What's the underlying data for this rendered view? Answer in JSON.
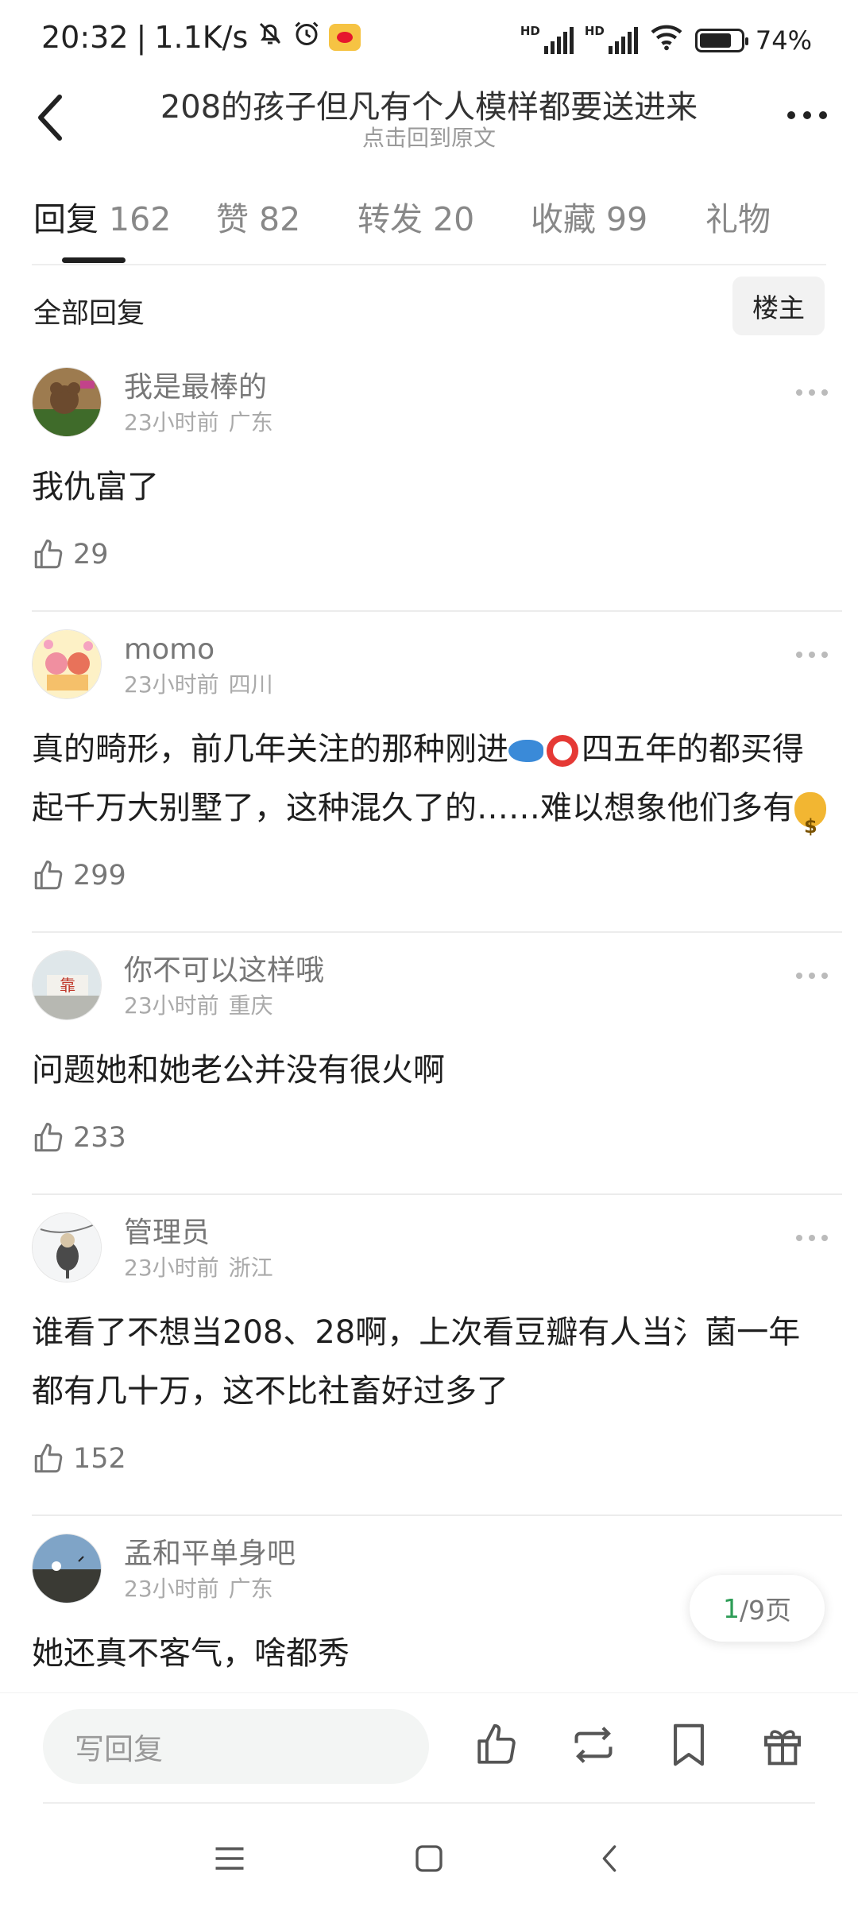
{
  "status_bar": {
    "time": "20:32",
    "net_speed": "1.1K/s",
    "hd1": "HD",
    "hd2": "HD",
    "battery": "74%"
  },
  "header": {
    "title": "208的孩子但凡有个人模样都要送进来",
    "subtitle": "点击回到原文"
  },
  "tabs": [
    {
      "label": "回复",
      "count": "162"
    },
    {
      "label": "赞",
      "count": "82"
    },
    {
      "label": "转发",
      "count": "20"
    },
    {
      "label": "收藏",
      "count": "99"
    },
    {
      "label": "礼物",
      "count": ""
    }
  ],
  "filter": {
    "all_label": "全部回复",
    "op_label": "楼主"
  },
  "comments": [
    {
      "name": "我是最棒的",
      "time": "23小时前",
      "location": "广东",
      "text": "我仇富了",
      "likes": "29"
    },
    {
      "name": "momo",
      "time": "23小时前",
      "location": "四川",
      "text_a": "真的畸形，前几年关注的那种刚进",
      "text_b": "四五年的都买得起千万大别墅了，这种混久了的……难以想象他们多有",
      "likes": "299"
    },
    {
      "name": "你不可以这样哦",
      "time": "23小时前",
      "location": "重庆",
      "text": "问题她和她老公并没有很火啊",
      "likes": "233"
    },
    {
      "name": "管理员",
      "time": "23小时前",
      "location": "浙江",
      "text": "谁看了不想当208、28啊，上次看豆瓣有人当氵菌一年都有几十万，这不比社畜好过多了",
      "likes": "152"
    },
    {
      "name": "孟和平单身吧",
      "time": "23小时前",
      "location": "广东",
      "text": "她还真不客气，啥都秀",
      "likes": ""
    }
  ],
  "pagination": {
    "current": "1",
    "total_text": "/9页"
  },
  "reply_bar": {
    "placeholder": "写回复"
  },
  "colors": {
    "accent_green": "#2e9d57",
    "text_primary": "#1f1f1f",
    "text_secondary": "#777777"
  }
}
